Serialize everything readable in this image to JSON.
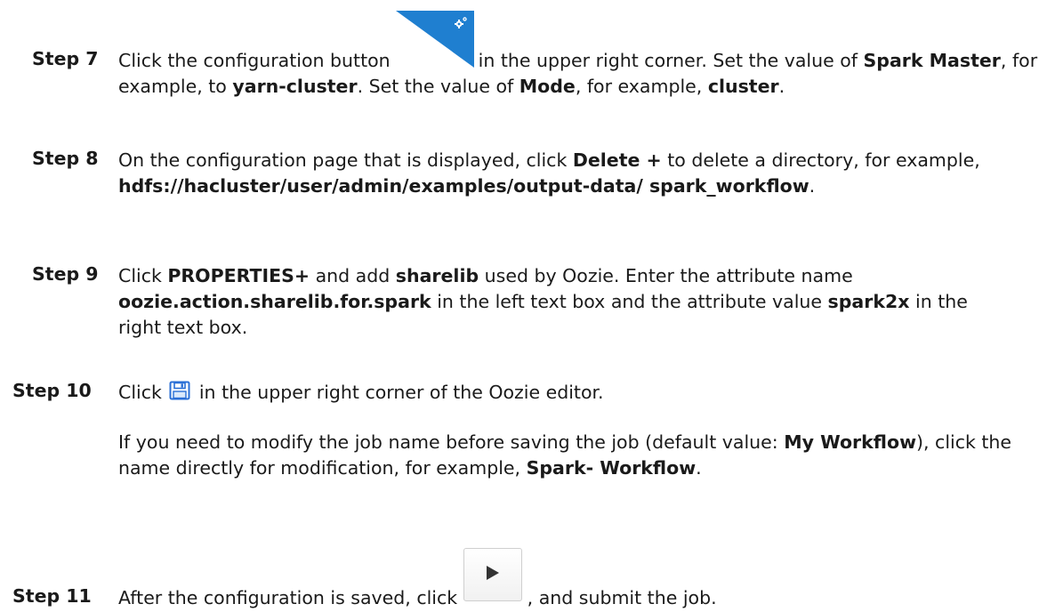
{
  "steps": [
    {
      "label": "Step 7",
      "parts": {
        "t1": "Click the configuration button ",
        "t2": " in the upper right corner. Set the value of ",
        "b1": "Spark Master",
        "t3": ", for example, to ",
        "b2": "yarn-cluster",
        "t4": ". Set the value of ",
        "b3": "Mode",
        "t5": ", for example, ",
        "b4": "cluster",
        "t6": "."
      },
      "icon": "configuration-gear-corner-icon"
    },
    {
      "label": "Step 8",
      "parts": {
        "t1": "On the configuration page that is displayed, click ",
        "b1": "Delete +",
        "t2": " to delete a directory, for example, ",
        "b2": "hdfs://hacluster/user/admin/examples/output-data/ spark_workflow",
        "t3": "."
      }
    },
    {
      "label": "Step 9",
      "parts": {
        "t1": "Click ",
        "b1": "PROPERTIES+",
        "t2": " and add ",
        "b2": "sharelib",
        "t3": " used by Oozie. Enter the attribute name ",
        "b3": "oozie.action.sharelib.for.spark",
        "t4": " in the left text box and the attribute value ",
        "b4": "spark2x",
        "t5": " in the right text box."
      }
    },
    {
      "label": "Step 10",
      "parts": {
        "t1": "Click",
        "t2": "in the upper right corner of the Oozie editor."
      },
      "icon": "save-floppy-icon",
      "note": {
        "t1": "If you need to modify the job name before saving the job (default value: ",
        "b1": "My Workflow",
        "t2": "), click the name directly for modification, for example, ",
        "b2": "Spark- Workflow",
        "t3": "."
      }
    },
    {
      "label": "Step 11",
      "parts": {
        "t1": "After the configuration is saved, click ",
        "t2": ", and submit the job."
      },
      "icon": "play-submit-icon"
    }
  ],
  "colors": {
    "text": "#1a1a1a",
    "config_icon_bg": "#1f7fd0",
    "save_icon": "#2a6fd6",
    "play_icon": "#333333"
  }
}
